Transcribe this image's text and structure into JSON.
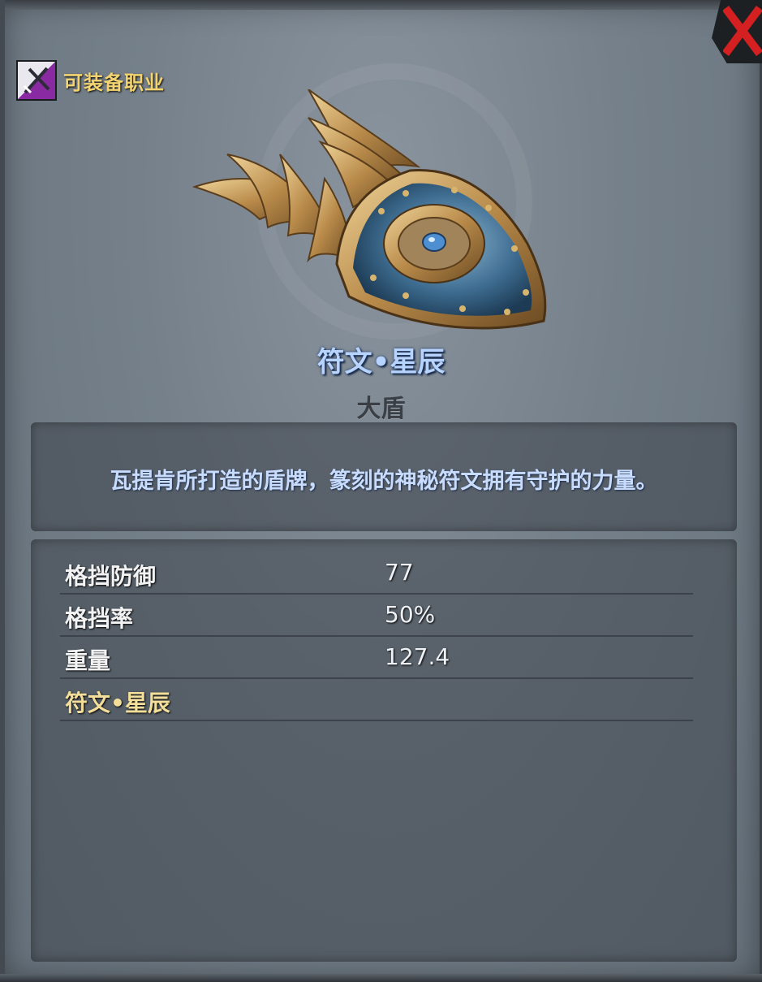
{
  "header": {
    "class_icon": "sword-class-icon",
    "class_label": "可装备职业",
    "close_icon": "close-x-icon"
  },
  "item": {
    "image": "winged-shield-image",
    "name": "符文•星辰",
    "type": "大盾",
    "description": "瓦提肯所打造的盾牌，篆刻的神秘符文拥有守护的力量。"
  },
  "stats": [
    {
      "label": "格挡防御",
      "value": "77"
    },
    {
      "label": "格挡率",
      "value": "50%"
    },
    {
      "label": "重量",
      "value": "127.4"
    },
    {
      "label": "符文•星辰",
      "value": ""
    }
  ],
  "colors": {
    "name": "#b7d3ff",
    "gold": "#f3d470",
    "close": "#d42020"
  }
}
